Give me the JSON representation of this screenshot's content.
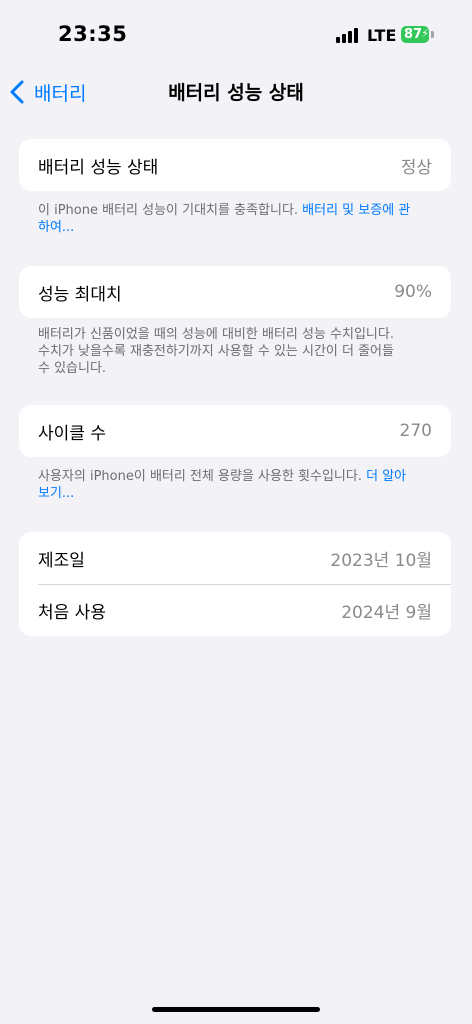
{
  "status_bar": {
    "time": "23:35",
    "network": "LTE",
    "battery_level": "87"
  },
  "nav": {
    "back_label": "배터리",
    "title": "배터리 성능 상태"
  },
  "health_card": {
    "label": "배터리 성능 상태",
    "value": "정상"
  },
  "health_footer": {
    "text": "이 iPhone 배터리 성능이 기대치를 충족합니다. ",
    "link": "배터리 및 보증에 관하여..."
  },
  "capacity_card": {
    "label": "성능 최대치",
    "value": "90%"
  },
  "capacity_footer": {
    "text": "배터리가 신품이었을 때의 성능에 대비한 배터리 성능 수치입니다. 수치가 낮을수록 재충전하기까지 사용할 수 있는 시간이 더 줄어들 수 있습니다."
  },
  "cycle_card": {
    "label": "사이클 수",
    "value": "270"
  },
  "cycle_footer": {
    "text": "사용자의 iPhone이 배터리 전체 용량을 사용한 횟수입니다. ",
    "link": "더 알아보기..."
  },
  "dates_card": {
    "manufacture_label": "제조일",
    "manufacture_value": "2023년 10월",
    "first_use_label": "처음 사용",
    "first_use_value": "2024년 9월"
  },
  "colors": {
    "accent": "#007aff",
    "battery": "#34c759",
    "background": "#f2f2f7"
  }
}
